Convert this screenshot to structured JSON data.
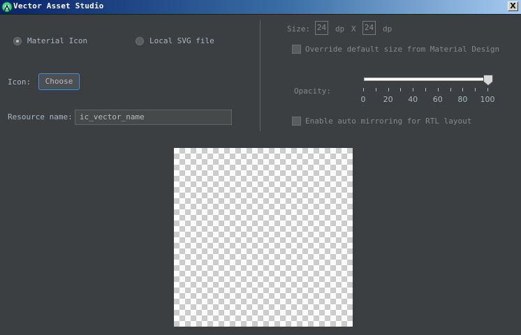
{
  "window": {
    "title": "Vector Asset Studio",
    "close_glyph": "X"
  },
  "source": {
    "options": [
      {
        "label": "Material Icon",
        "selected": true
      },
      {
        "label": "Local SVG file",
        "selected": false
      }
    ]
  },
  "icon": {
    "label": "Icon:",
    "button_label": "Choose"
  },
  "resource": {
    "label": "Resource name:",
    "value": "ic_vector_name"
  },
  "size": {
    "label": "Size:",
    "width": "24",
    "height": "24",
    "unit": "dp",
    "separator": "X"
  },
  "override": {
    "label": "Override default size from Material Design",
    "checked": false
  },
  "opacity": {
    "label": "Opacity:",
    "value": 100,
    "min": 0,
    "max": 100,
    "tick_labels": [
      "0",
      "20",
      "40",
      "60",
      "80",
      "100"
    ],
    "minor_ticks": 11
  },
  "mirroring": {
    "label": "Enable auto mirroring for RTL layout",
    "checked": false
  },
  "icons": {
    "app": "android-studio-icon",
    "slider_thumb": "slider-thumb-icon"
  }
}
